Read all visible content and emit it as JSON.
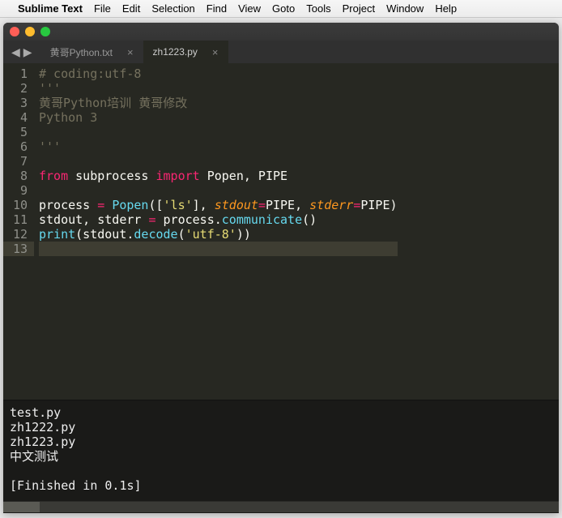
{
  "menubar": {
    "app": "Sublime Text",
    "items": [
      "File",
      "Edit",
      "Selection",
      "Find",
      "View",
      "Goto",
      "Tools",
      "Project",
      "Window",
      "Help"
    ]
  },
  "tabs": [
    {
      "label": "黄哥Python.txt",
      "active": false
    },
    {
      "label": "zh1223.py",
      "active": true
    }
  ],
  "nav": {
    "back": "◀",
    "fwd": "▶"
  },
  "code": {
    "lines": [
      [
        {
          "t": "# coding:utf-8",
          "c": "c-comment"
        }
      ],
      [
        {
          "t": "'''",
          "c": "c-comment"
        }
      ],
      [
        {
          "t": "黄哥Python培训 黄哥修改",
          "c": "c-comment"
        }
      ],
      [
        {
          "t": "Python 3",
          "c": "c-comment"
        }
      ],
      [],
      [
        {
          "t": "'''",
          "c": "c-comment"
        }
      ],
      [],
      [
        {
          "t": "from",
          "c": "c-keyword"
        },
        {
          "t": " subprocess ",
          "c": "c-plain"
        },
        {
          "t": "import",
          "c": "c-import"
        },
        {
          "t": " Popen, PIPE",
          "c": "c-plain"
        }
      ],
      [],
      [
        {
          "t": "process ",
          "c": "c-plain"
        },
        {
          "t": "=",
          "c": "c-op"
        },
        {
          "t": " ",
          "c": "c-plain"
        },
        {
          "t": "Popen",
          "c": "c-builtin"
        },
        {
          "t": "([",
          "c": "c-plain"
        },
        {
          "t": "'ls'",
          "c": "c-string"
        },
        {
          "t": "], ",
          "c": "c-plain"
        },
        {
          "t": "stdout",
          "c": "c-arg"
        },
        {
          "t": "=",
          "c": "c-op"
        },
        {
          "t": "PIPE, ",
          "c": "c-plain"
        },
        {
          "t": "stderr",
          "c": "c-arg"
        },
        {
          "t": "=",
          "c": "c-op"
        },
        {
          "t": "PIPE)",
          "c": "c-plain"
        }
      ],
      [
        {
          "t": "stdout, stderr ",
          "c": "c-plain"
        },
        {
          "t": "=",
          "c": "c-op"
        },
        {
          "t": " process.",
          "c": "c-plain"
        },
        {
          "t": "communicate",
          "c": "c-func"
        },
        {
          "t": "()",
          "c": "c-plain"
        }
      ],
      [
        {
          "t": "print",
          "c": "c-builtin"
        },
        {
          "t": "(stdout.",
          "c": "c-plain"
        },
        {
          "t": "decode",
          "c": "c-func"
        },
        {
          "t": "(",
          "c": "c-plain"
        },
        {
          "t": "'utf-8'",
          "c": "c-string"
        },
        {
          "t": "))",
          "c": "c-plain"
        }
      ],
      []
    ],
    "highlight_line": 13
  },
  "console": {
    "lines": [
      "test.py",
      "zh1222.py",
      "zh1223.py",
      "中文测试",
      "",
      "[Finished in 0.1s]"
    ]
  }
}
